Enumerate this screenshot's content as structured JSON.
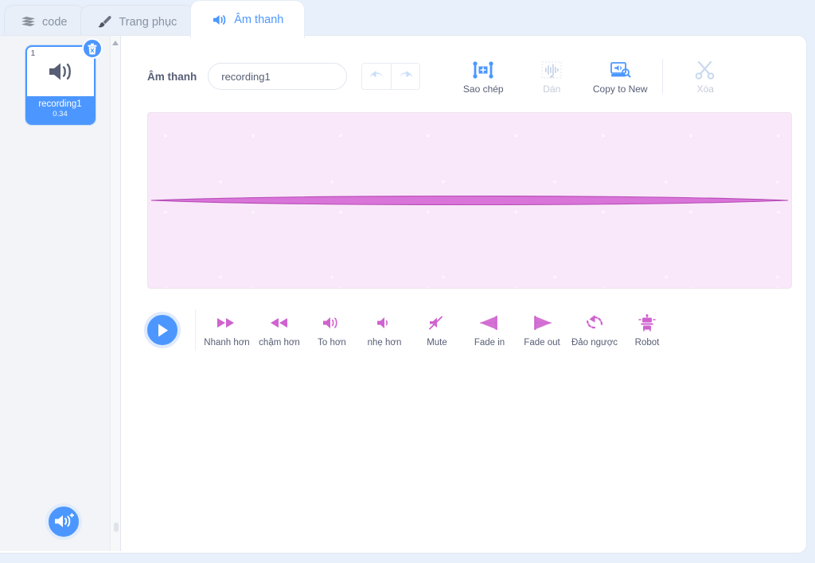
{
  "tabs": [
    {
      "label": "code",
      "icon": "blocks-icon",
      "active": false
    },
    {
      "label": "Trang phục",
      "icon": "paintbrush-icon",
      "active": false
    },
    {
      "label": "Âm thanh",
      "icon": "speaker-icon",
      "active": true
    }
  ],
  "selector": {
    "sounds": [
      {
        "index": "1",
        "name": "recording1",
        "duration": "0.34",
        "selected": true
      }
    ],
    "delete_badge": "trash-icon",
    "add_sound_label": "add-sound-icon"
  },
  "toolbar": {
    "sound_label": "Âm thanh",
    "name_value": "recording1",
    "name_placeholder": "recording1",
    "undo_label": "undo-icon",
    "redo_label": "redo-icon",
    "actions": [
      {
        "label": "Sao chép",
        "icon": "copy-icon",
        "disabled": false
      },
      {
        "label": "Dán",
        "icon": "paste-icon",
        "disabled": true
      },
      {
        "label": "Copy to New",
        "icon": "copy-to-new-icon",
        "disabled": false
      },
      {
        "label": "Xóa",
        "icon": "scissors-icon",
        "disabled": true
      }
    ]
  },
  "waveform": {
    "background_color": "#f9e8f9",
    "wave_color": "#cf63cf",
    "wave_fill": "#d974d9",
    "description": "flat quiet recording rendered as thin lens shape"
  },
  "effects": {
    "play_label": "play-icon",
    "items": [
      {
        "label": "Nhanh hơn",
        "icon": "fast-forward-icon"
      },
      {
        "label": "chậm hơn",
        "icon": "rewind-icon"
      },
      {
        "label": "To hơn",
        "icon": "volume-up-icon"
      },
      {
        "label": "nhẹ hơn",
        "icon": "volume-down-icon"
      },
      {
        "label": "Mute",
        "icon": "mute-icon"
      },
      {
        "label": "Fade in",
        "icon": "fade-in-icon"
      },
      {
        "label": "Fade out",
        "icon": "fade-out-icon"
      },
      {
        "label": "Đảo ngược",
        "icon": "reverse-icon"
      },
      {
        "label": "Robot",
        "icon": "robot-icon"
      }
    ]
  },
  "colors": {
    "accent_blue": "#4c97ff",
    "page_bg": "#e8f0fc",
    "sound_wave_pink": "#cf63cf",
    "text_gray": "#575e75",
    "disabled_gray": "#c4cbd8"
  }
}
